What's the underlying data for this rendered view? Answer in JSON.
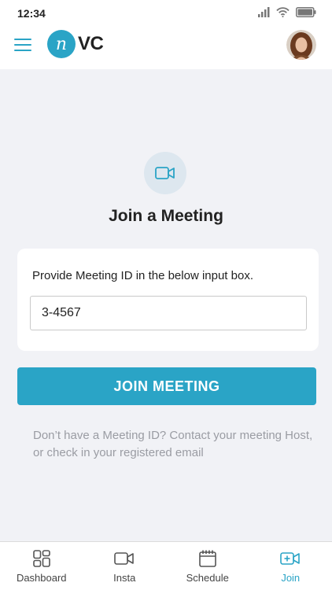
{
  "status_bar": {
    "time": "12:34"
  },
  "app_bar": {
    "logo_letter": "n",
    "logo_text": "VC"
  },
  "hero": {
    "icon": "video-camera-icon"
  },
  "page": {
    "title": "Join a Meeting"
  },
  "meeting_card": {
    "label": "Provide Meeting ID in the below input box.",
    "input_value": "3-4567"
  },
  "join_button": {
    "label": "JOIN  MEETING"
  },
  "help": {
    "text": "Don’t have a Meeting ID?  Contact your meeting Host, or check in your registered email"
  },
  "bottom_nav": {
    "items": [
      {
        "label": "Dashboard",
        "icon": "dashboard-grid-icon"
      },
      {
        "label": "Insta",
        "icon": "video-camera-icon"
      },
      {
        "label": "Schedule",
        "icon": "calendar-icon"
      },
      {
        "label": "Join",
        "icon": "video-plus-icon",
        "active": true
      }
    ]
  },
  "colors": {
    "accent": "#2aa4c6",
    "background": "#f1f2f6",
    "muted_text": "#9a9ca3"
  }
}
